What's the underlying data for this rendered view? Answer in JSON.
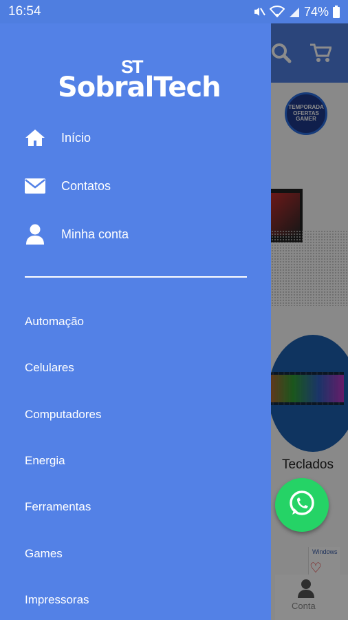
{
  "status_bar": {
    "time": "16:54",
    "battery": "74%",
    "icons": [
      "mute-icon",
      "wifi-icon",
      "signal-icon",
      "battery-icon"
    ]
  },
  "background": {
    "promo_badge": "TEMPORADA OFERTAS GAMER",
    "category_label": "Teclados",
    "ad_label": "Windows",
    "bottom_nav_label": "Conta",
    "header_icons": [
      "search-icon",
      "cart-icon"
    ]
  },
  "drawer": {
    "logo": {
      "mark": "ST",
      "text": "SobralTech"
    },
    "nav": [
      {
        "label": "Início",
        "icon": "home-icon"
      },
      {
        "label": "Contatos",
        "icon": "envelope-icon"
      },
      {
        "label": "Minha conta",
        "icon": "user-icon"
      }
    ],
    "categories": [
      "Automação",
      "Celulares",
      "Computadores",
      "Energia",
      "Ferramentas",
      "Games",
      "Impressoras"
    ]
  },
  "colors": {
    "drawer": "#5381e6",
    "header": "#4f7ee0",
    "whatsapp": "#25d366"
  }
}
